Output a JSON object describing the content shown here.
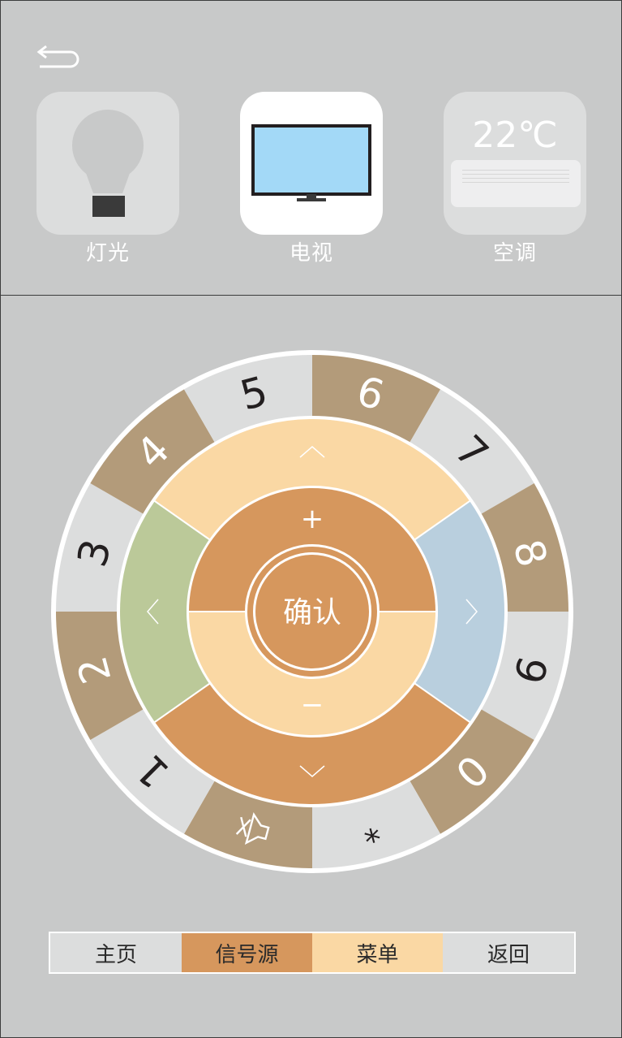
{
  "nav": {
    "back_icon": "back-arrow-icon"
  },
  "devices": [
    {
      "id": "light",
      "label": "灯光",
      "icon": "light-bulb-icon"
    },
    {
      "id": "tv",
      "label": "电视",
      "icon": "tv-icon",
      "selected": true
    },
    {
      "id": "ac",
      "label": "空调",
      "icon": "air-conditioner-icon",
      "temperature": "22℃"
    }
  ],
  "remote": {
    "ok_label": "确认",
    "volume_up_label": "+",
    "volume_down_label": "−",
    "number_keys": [
      "1",
      "2",
      "3",
      "4",
      "5",
      "6",
      "7",
      "8",
      "9",
      "0"
    ],
    "star_key": "*",
    "mute_icon": "mute-icon",
    "directions": [
      "up",
      "down",
      "left",
      "right"
    ],
    "colors": {
      "tan": "#b39b7a",
      "light_gray": "#dcdddd",
      "peach": "#fad8a4",
      "orange": "#d6975d",
      "green": "#bbc999",
      "blue": "#b9cfde"
    }
  },
  "bottom_bar": [
    {
      "label": "主页",
      "bg": "#dcdddd"
    },
    {
      "label": "信号源",
      "bg": "#d6975d"
    },
    {
      "label": "菜单",
      "bg": "#fad8a4"
    },
    {
      "label": "返回",
      "bg": "#dcdddd"
    }
  ]
}
